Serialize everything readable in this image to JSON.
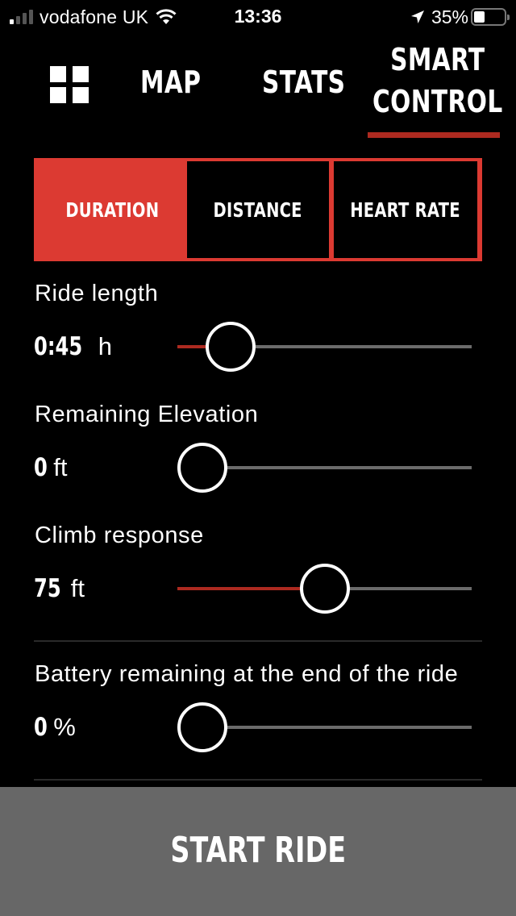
{
  "status_bar": {
    "carrier": "vodafone UK",
    "signal_bars_active": 1,
    "signal_bars_total": 4,
    "time": "13:36",
    "battery_percent_label": "35%",
    "battery_level": 0.35,
    "icons": [
      "signal-icon",
      "wifi-icon",
      "location-arrow-icon",
      "battery-icon"
    ]
  },
  "header": {
    "menu_icon": "grid-icon",
    "tabs": [
      {
        "label": "MAP",
        "active": false
      },
      {
        "label": "STATS",
        "active": false
      },
      {
        "label_line1": "SMART",
        "label_line2": "CONTROL",
        "active": true
      }
    ]
  },
  "mode_selector": {
    "options": [
      {
        "label": "DURATION",
        "active": true
      },
      {
        "label": "DISTANCE",
        "active": false
      },
      {
        "label": "HEART RATE",
        "active": false
      }
    ]
  },
  "settings": [
    {
      "label": "Ride length",
      "value": "0:45",
      "unit": "h",
      "fraction": 0.115
    },
    {
      "label": "Remaining Elevation",
      "value": "0",
      "unit": "ft",
      "fraction": 0
    },
    {
      "label": "Climb response",
      "value": "75",
      "unit": "ft",
      "fraction": 0.5
    },
    {
      "label": "Battery remaining at the end of the ride",
      "value": "0",
      "unit": "%",
      "fraction": 0
    }
  ],
  "footer": {
    "start_label": "START RIDE"
  },
  "colors": {
    "accent_red": "#dc3a32",
    "dark_red": "#ad2a20",
    "track_gray": "#6b6b6b",
    "button_gray": "#676767",
    "background": "#000000"
  }
}
